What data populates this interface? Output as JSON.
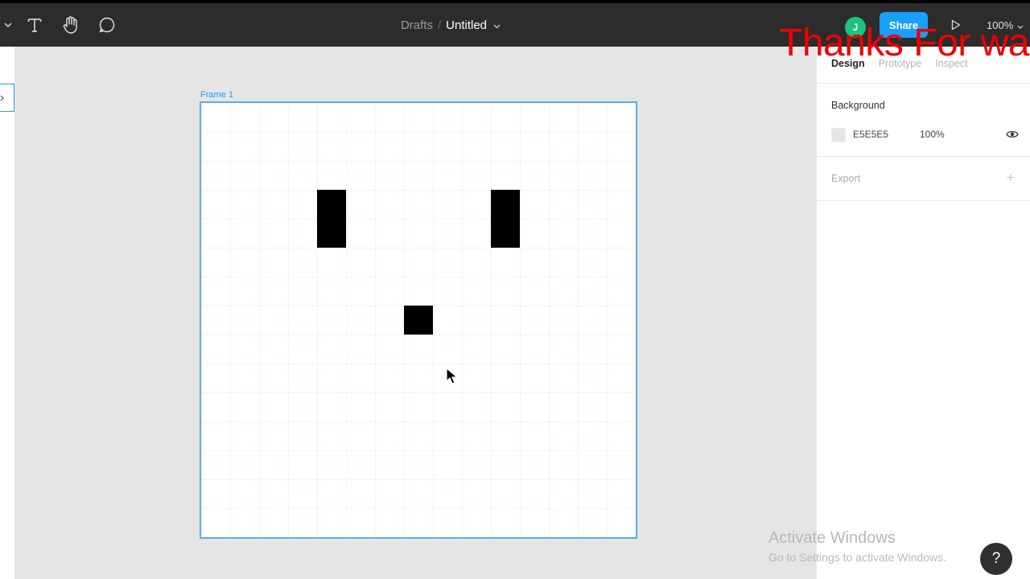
{
  "toolbar": {
    "breadcrumb_parent": "Drafts",
    "breadcrumb_separator": "/",
    "file_name": "Untitled",
    "avatar_initial": "J",
    "share_label": "Share",
    "zoom_level": "100%",
    "icons": [
      "chevron-down-icon",
      "text-tool-icon",
      "hand-tool-icon",
      "comment-tool-icon",
      "play-icon"
    ]
  },
  "canvas": {
    "frame_label": "Frame 1",
    "frame_fill": "#ffffff",
    "frame_border_color": "#5ab0e6",
    "pixel_color": "#000000"
  },
  "design_panel": {
    "tabs": [
      "Design",
      "Prototype",
      "Inspect"
    ],
    "active_tab": "Design",
    "background_title": "Background",
    "background_hex": "E5E5E5",
    "background_opacity": "100%",
    "export_label": "Export",
    "export_add_symbol": "+"
  },
  "overlay": {
    "caption": "Thanks For wa",
    "caption_color": "#ee0000",
    "watermark_title": "Activate Windows",
    "watermark_subtitle": "Go to Settings to activate Windows.",
    "help_symbol": "?"
  },
  "colors": {
    "toolbar_bg": "#2c2c2c",
    "accent": "#18a0fb",
    "avatar_bg": "#1bc47d",
    "canvas_bg": "#e5e5e5"
  }
}
